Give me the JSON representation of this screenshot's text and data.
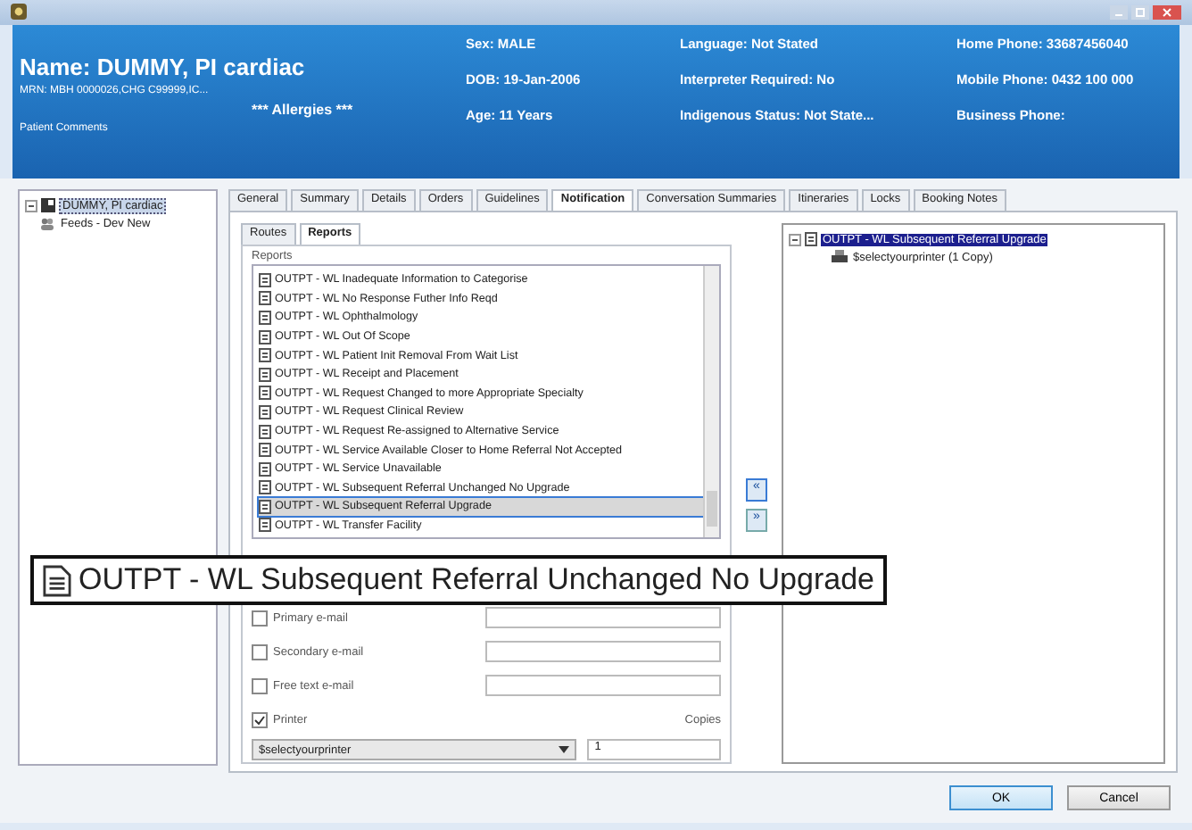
{
  "header": {
    "name": "Name: DUMMY, PI cardiac",
    "mrn": "MRN: MBH 0000026,CHG C99999,IC...",
    "allergies": "*** Allergies ***",
    "comments": "Patient Comments",
    "columns": [
      [
        "Sex: MALE",
        "DOB: 19-Jan-2006",
        "Age: 11 Years"
      ],
      [
        "Language: Not Stated",
        "Interpreter Required: No",
        "Indigenous Status: Not State..."
      ],
      [
        "Home Phone: 33687456040",
        "Mobile Phone: 0432 100 000",
        "Business Phone:"
      ]
    ]
  },
  "tree": [
    {
      "label": "DUMMY, PI cardiac",
      "selected": true,
      "expanded": true,
      "children": [
        {
          "label": "Feeds - Dev New",
          "selected": false
        }
      ]
    }
  ],
  "tabs": [
    {
      "label": "General",
      "selected": false
    },
    {
      "label": "Summary",
      "selected": false
    },
    {
      "label": "Details",
      "selected": false
    },
    {
      "label": "Orders",
      "selected": false
    },
    {
      "label": "Guidelines",
      "selected": false
    },
    {
      "label": "Notification",
      "selected": true
    },
    {
      "label": "Conversation Summaries",
      "selected": false
    },
    {
      "label": "Itineraries",
      "selected": false
    },
    {
      "label": "Locks",
      "selected": false
    },
    {
      "label": "Booking Notes",
      "selected": false
    }
  ],
  "subtabs": [
    {
      "label": "Routes",
      "selected": false
    },
    {
      "label": "Reports",
      "selected": true
    }
  ],
  "reports": {
    "label": "Reports",
    "items": [
      {
        "label": "OUTPT - WL Inadequate Information to Categorise",
        "selected": false
      },
      {
        "label": "OUTPT - WL No Response Futher Info Reqd",
        "selected": false
      },
      {
        "label": "OUTPT - WL Ophthalmology",
        "selected": false
      },
      {
        "label": "OUTPT - WL Out Of Scope",
        "selected": false
      },
      {
        "label": "OUTPT - WL Patient Init Removal From Wait List",
        "selected": false
      },
      {
        "label": "OUTPT - WL Receipt and Placement",
        "selected": false
      },
      {
        "label": "OUTPT - WL Request Changed to more Appropriate Specialty",
        "selected": false
      },
      {
        "label": "OUTPT - WL Request Clinical Review",
        "selected": false
      },
      {
        "label": "OUTPT - WL Request Re-assigned to Alternative Service",
        "selected": false
      },
      {
        "label": "OUTPT - WL Service Available Closer to Home Referral Not Accepted",
        "selected": false
      },
      {
        "label": "OUTPT - WL Service Unavailable",
        "selected": false
      },
      {
        "label": "OUTPT - WL Subsequent Referral Unchanged No Upgrade",
        "selected": false
      },
      {
        "label": "OUTPT - WL Subsequent Referral Upgrade",
        "selected": true
      },
      {
        "label": "OUTPT - WL Transfer Facility",
        "selected": false
      }
    ]
  },
  "move_buttons": [
    "«",
    "»"
  ],
  "emails": [
    {
      "label": "Primary e-mail",
      "checked": false
    },
    {
      "label": "Secondary e-mail",
      "checked": false
    },
    {
      "label": "Free text e-mail",
      "checked": false
    }
  ],
  "printer": {
    "label": "Printer",
    "checked": true,
    "value": "$selectyourprinter",
    "copies_label": "Copies",
    "copies": "1"
  },
  "selected_tree": [
    {
      "label": "OUTPT - WL Subsequent Referral Upgrade",
      "selected": true,
      "children": [
        {
          "label": "$selectyourprinter (1 Copy)",
          "selected": false
        }
      ]
    }
  ],
  "buttons": [
    "OK",
    "Cancel"
  ],
  "callout": "OUTPT - WL Subsequent Referral Unchanged No Upgrade"
}
